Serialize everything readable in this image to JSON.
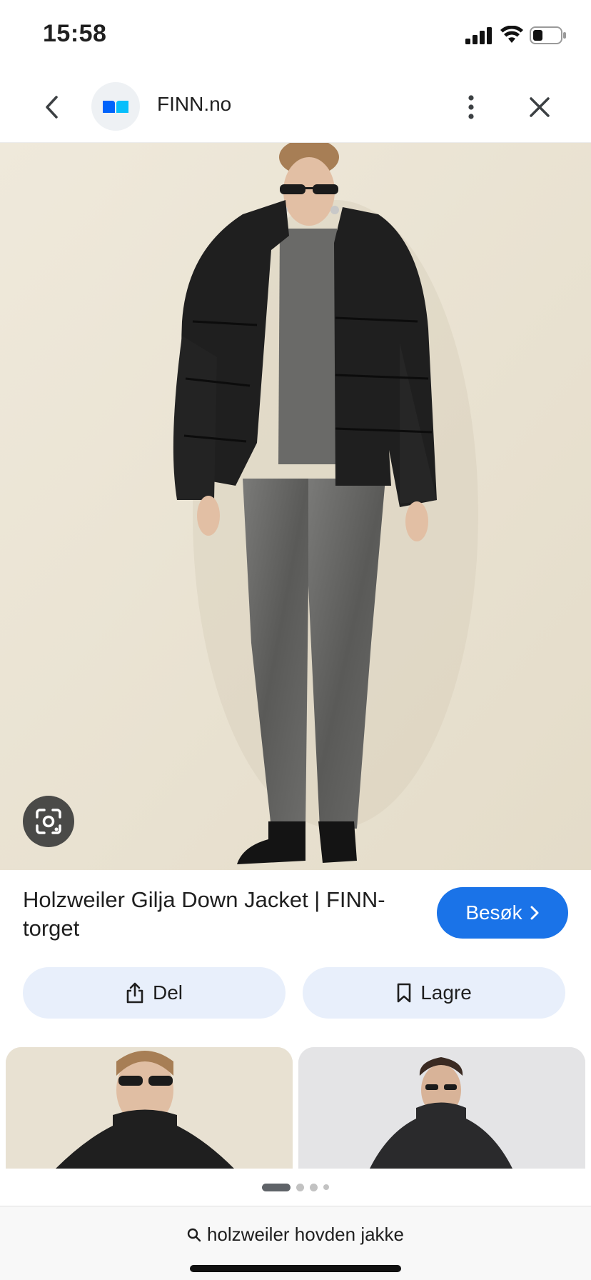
{
  "status_bar": {
    "time": "15:58"
  },
  "browser": {
    "site_name": "FINN.no"
  },
  "result": {
    "title": "Holzweiler Gilja Down Jacket | FINN-torget",
    "visit_label": "Besøk",
    "share_label": "Del",
    "save_label": "Lagre"
  },
  "bottom": {
    "search_query": "holzweiler hovden jakke"
  },
  "pager": {
    "pages": 4,
    "active_index": 0
  },
  "icons": {
    "back": "chevron-left-icon",
    "menu": "more-vertical-icon",
    "close": "close-icon",
    "lens": "google-lens-icon",
    "share": "share-icon",
    "save": "bookmark-icon",
    "search": "search-icon",
    "visit": "chevron-right-icon"
  },
  "colors": {
    "accent": "#1a73e8",
    "chip_bg": "#e8effb"
  }
}
